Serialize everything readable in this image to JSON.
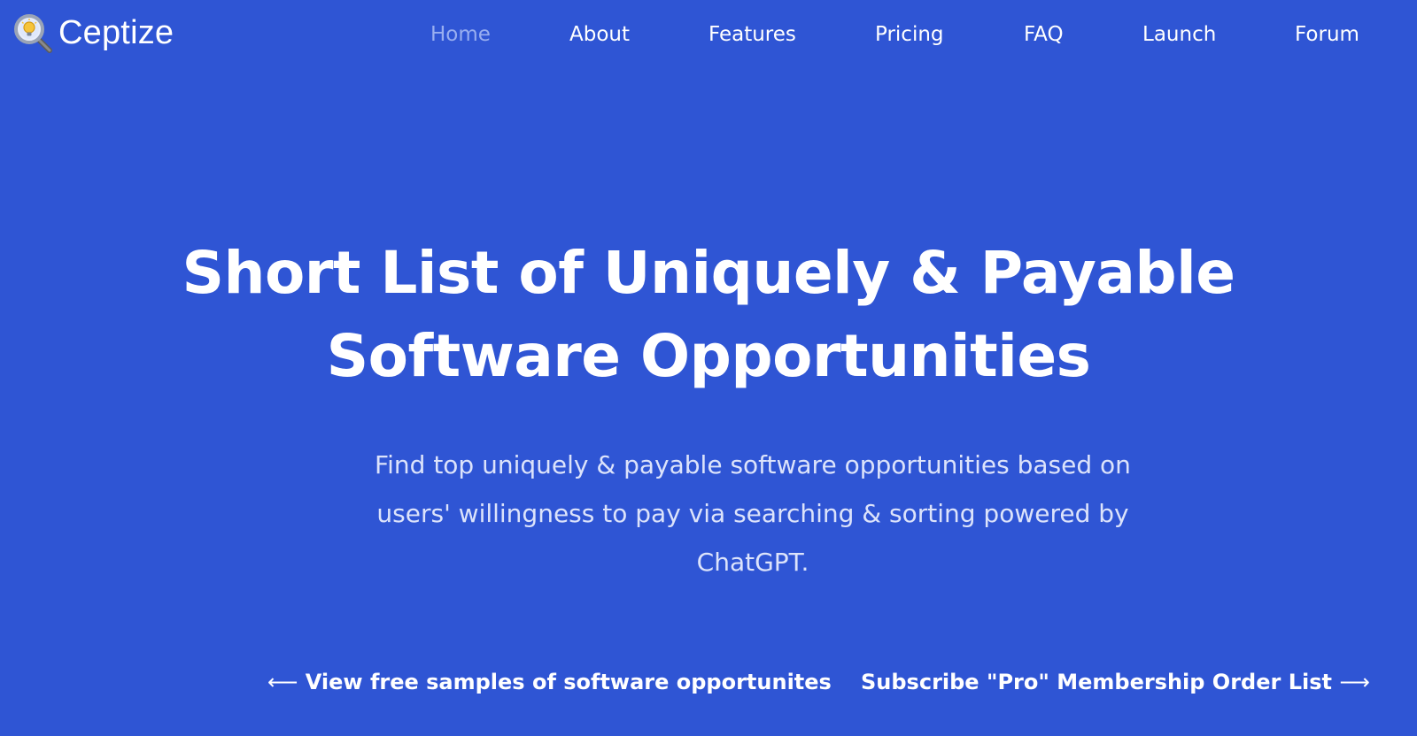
{
  "brand": {
    "name": "Ceptize",
    "logo_icon": "magnifier-lightbulb-icon"
  },
  "nav": {
    "items": [
      {
        "label": "Home",
        "active": true
      },
      {
        "label": "About",
        "active": false
      },
      {
        "label": "Features",
        "active": false
      },
      {
        "label": "Pricing",
        "active": false
      },
      {
        "label": "FAQ",
        "active": false
      },
      {
        "label": "Launch",
        "active": false
      },
      {
        "label": "Forum",
        "active": false
      }
    ]
  },
  "hero": {
    "title_line1": "Short List of Uniquely & Payable",
    "title_line2": "Software Opportunities",
    "subtitle_line1": "Find top uniquely & payable software opportunities based on",
    "subtitle_line2": "users' willingness to pay via searching & sorting powered by",
    "subtitle_line3": "ChatGPT."
  },
  "cta": {
    "left_arrow": "⟵",
    "left_label": "View free samples of software opportunites",
    "right_label": "Subscribe \"Pro\" Membership Order List",
    "right_arrow": "⟶"
  },
  "colors": {
    "background": "#2f55d4",
    "text": "#ffffff",
    "nav_active": "#98aef0",
    "subtitle": "#dce3fb"
  }
}
